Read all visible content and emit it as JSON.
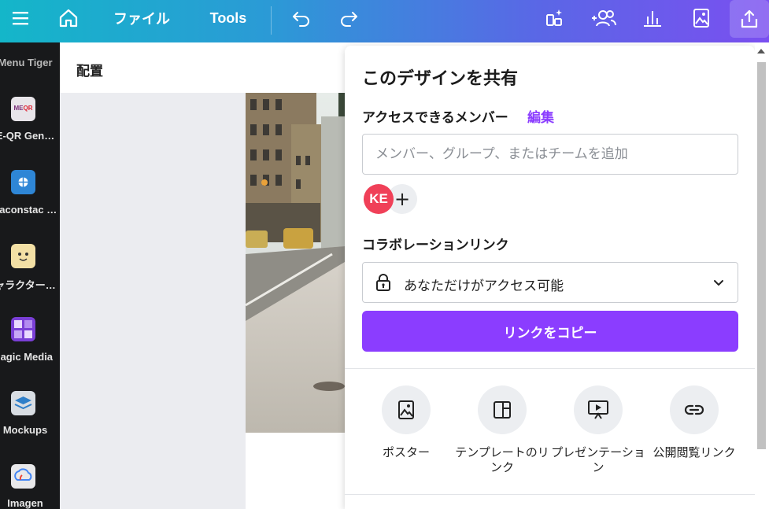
{
  "topbar": {
    "file_label": "ファイル",
    "tools_label": "Tools",
    "icons": [
      "menu-icon",
      "home-icon",
      "undo-icon",
      "redo-icon",
      "magic-resize-icon",
      "collaborators-icon",
      "insights-icon",
      "image-icon",
      "share-upload-icon"
    ]
  },
  "sidebar": {
    "items": [
      {
        "label": "Menu Tiger",
        "icon": "menu-tiger-icon"
      },
      {
        "label": "E-QR Gen…",
        "icon": "qr-generator-icon",
        "color": "#e8e5ea"
      },
      {
        "label": "eaconstac …",
        "icon": "beaconstac-icon",
        "color": "#2e86d6"
      },
      {
        "label": "ャラクター…",
        "icon": "character-icon",
        "color": "#f3e0a5"
      },
      {
        "label": "lagic Media",
        "icon": "magic-media-icon",
        "color": "#7a3fd6"
      },
      {
        "label": "Mockups",
        "icon": "mockups-icon",
        "color": "#d8dde3"
      },
      {
        "label": "Imagen",
        "icon": "imagen-icon",
        "color": "#e8e8ea"
      }
    ]
  },
  "toolbar2": {
    "arrange_label": "配置"
  },
  "share_panel": {
    "title": "このデザインを共有",
    "access_label": "アクセスできるメンバー",
    "edit_label": "編集",
    "member_input_placeholder": "メンバー、グループ、またはチームを追加",
    "avatar_initials": "KE",
    "add_symbol": "+",
    "collab_link_label": "コラボレーションリンク",
    "access_select_value": "あなただけがアクセス可能",
    "copy_link_label": "リンクをコピー",
    "options": [
      {
        "label": "ポスター",
        "icon": "poster-icon"
      },
      {
        "label": "テンプレートのリンク",
        "icon": "template-icon"
      },
      {
        "label": "プレゼンテーション",
        "icon": "presentation-icon"
      },
      {
        "label": "公開閲覧リンク",
        "icon": "link-icon"
      }
    ]
  },
  "colors": {
    "accent": "#8b3dff",
    "avatar": "#f04058",
    "sidebar_bg": "#18191b"
  }
}
